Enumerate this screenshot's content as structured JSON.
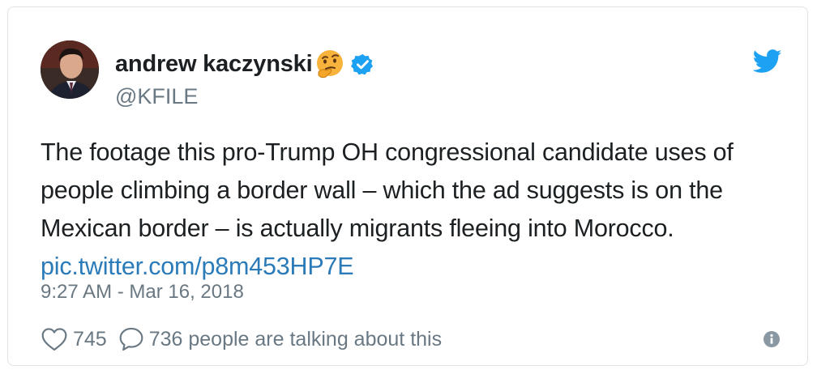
{
  "tweet": {
    "author_name": "andrew kaczynski",
    "author_handle": "@KFILE",
    "text_lines": [
      "The footage this pro-Trump OH congressional candidate uses of",
      "people climbing a border wall – which the ad suggests is on the",
      "Mexican border – is actually migrants fleeing into Morocco."
    ],
    "link": "pic.twitter.com/p8m453HP7E",
    "timestamp": "9:27 AM - Mar 16, 2018",
    "like_count": "745",
    "talking_text": "736 people are talking about this"
  },
  "icons": {
    "avatar": "profile-photo",
    "emoji": "thinking-face-emoji",
    "verified": "verified-badge-icon",
    "brand": "twitter-bird-icon",
    "like": "heart-outline-icon",
    "reply": "speech-bubble-icon",
    "info": "info-circle-icon"
  },
  "colors": {
    "text": "#1c2022",
    "muted": "#697882",
    "link": "#2b7bb9",
    "twitter_blue": "#1da1f2",
    "border": "#dfe3e7"
  }
}
